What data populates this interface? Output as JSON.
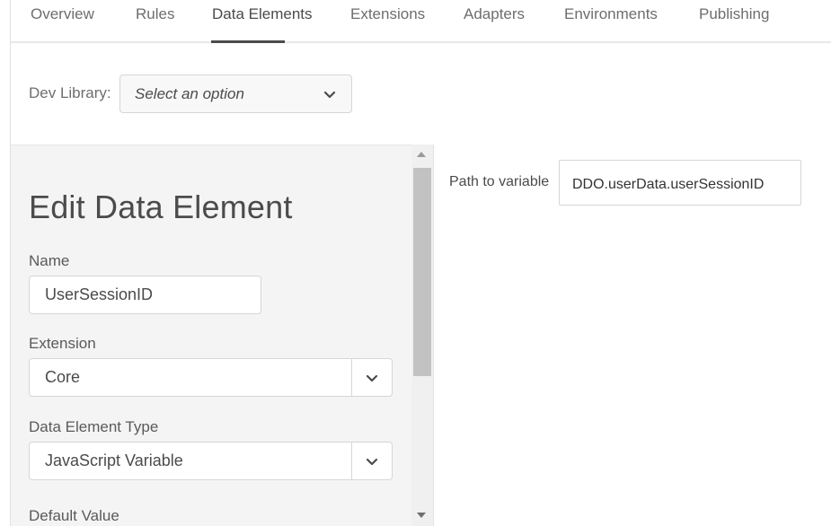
{
  "tabs": {
    "overview": "Overview",
    "rules": "Rules",
    "data_elements": "Data Elements",
    "extensions": "Extensions",
    "adapters": "Adapters",
    "environments": "Environments",
    "publishing": "Publishing",
    "active": "Data Elements"
  },
  "dev_library": {
    "label": "Dev Library:",
    "value": "Select an option"
  },
  "editor": {
    "title": "Edit Data Element",
    "name_label": "Name",
    "name_value": "UserSessionID",
    "extension_label": "Extension",
    "extension_value": "Core",
    "type_label": "Data Element Type",
    "type_value": "JavaScript Variable",
    "default_label": "Default Value"
  },
  "settings": {
    "path_label": "Path to variable",
    "path_value": "DDO.userData.userSessionID"
  },
  "icons": {
    "dropdown": "chevron-down-icon",
    "scroll_up": "scroll-up-arrow-icon",
    "scroll_down": "scroll-down-arrow-icon"
  }
}
